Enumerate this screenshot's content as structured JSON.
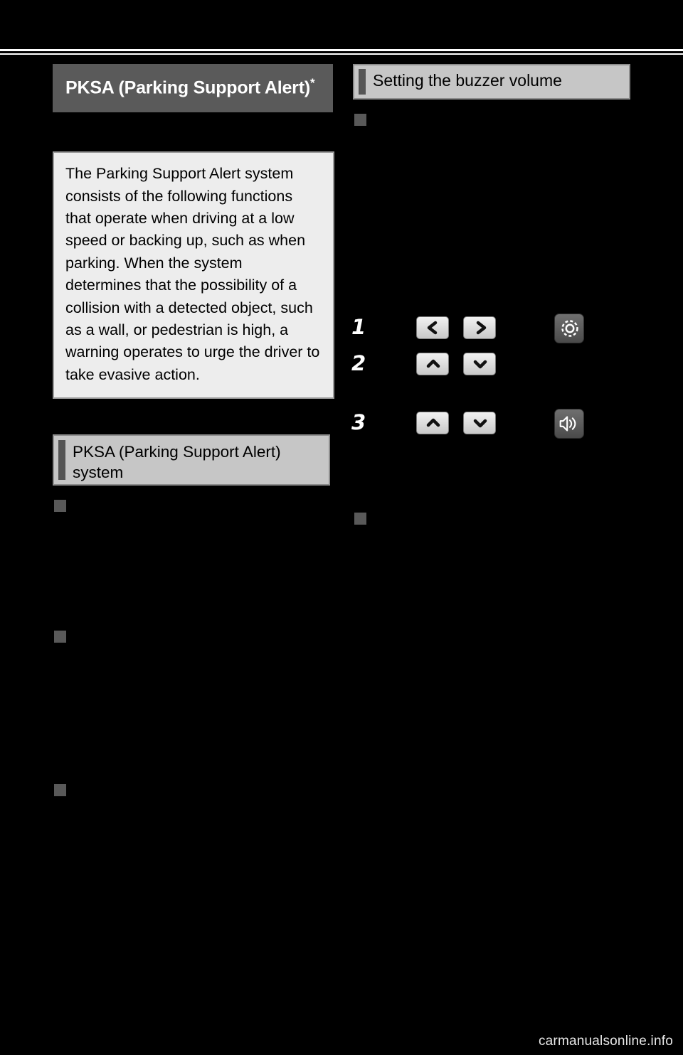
{
  "page": {
    "background_color": "#000000",
    "watermark": "carmanualsonline.info"
  },
  "left_column": {
    "main_header": {
      "title": "PKSA (Parking Support Alert)",
      "footnote_marker": "*"
    },
    "description_box": {
      "text": "The Parking Support Alert system consists of the following functions that operate when driving at a low speed or backing up, such as when parking. When the system determines that the possibility of a collision with a detected object, such as a wall, or pedestrian is high, a warning operates to urge the driver to take evasive action."
    },
    "section_header": {
      "title": "PKSA (Parking Support Alert) system"
    },
    "bullets": [
      {
        "label": ""
      },
      {
        "label": ""
      },
      {
        "label": ""
      }
    ]
  },
  "right_column": {
    "section_header": {
      "title": "Setting the buzzer volume"
    },
    "bullets": [
      {
        "label": ""
      },
      {
        "label": ""
      }
    ],
    "steps": [
      {
        "number": "1",
        "buttons": [
          "left-arrow-button",
          "right-arrow-button"
        ],
        "icon": "gear-icon"
      },
      {
        "number": "2",
        "buttons": [
          "up-arrow-button",
          "down-arrow-button"
        ],
        "icon": ""
      },
      {
        "number": "3",
        "buttons": [
          "up-arrow-button",
          "down-arrow-button"
        ],
        "icon": "speaker-volume-icon"
      }
    ]
  }
}
